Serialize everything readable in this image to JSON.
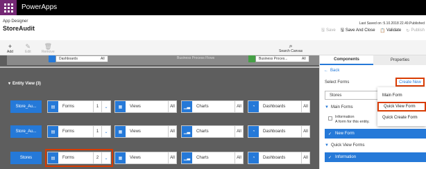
{
  "app": {
    "title": "PowerApps"
  },
  "header": {
    "breadcrumb": "App Designer",
    "title": "StoreAudit",
    "saved": "Last Saved on :5.10.2018 22.49.Published",
    "actions": [
      {
        "label": "Save",
        "icon": "save-icon",
        "enabled": false
      },
      {
        "label": "Save And Close",
        "icon": "save-close-icon",
        "enabled": true
      },
      {
        "label": "Validate",
        "icon": "validate-icon",
        "enabled": true
      },
      {
        "label": "Publish",
        "icon": "publish-icon",
        "enabled": false
      }
    ]
  },
  "commandbar": {
    "add": "Add",
    "edit": "Edit",
    "remove": "Remove",
    "search": "Search Canvas"
  },
  "canvas": {
    "top_partial": {
      "dashboards": "Dashboards",
      "all": "All",
      "business": "Business Process Flows",
      "business2": "Business Proces..."
    },
    "section": "Entity View (3)",
    "rows": [
      {
        "entity": "Store_Au...",
        "forms": "Forms",
        "forms_count": "1",
        "views": "Views",
        "views_count": "All",
        "charts": "Charts",
        "charts_count": "All",
        "dashboards": "Dashboards",
        "dashboards_count": "All"
      },
      {
        "entity": "Store_Au...",
        "forms": "Forms",
        "forms_count": "1",
        "views": "Views",
        "views_count": "All",
        "charts": "Charts",
        "charts_count": "All",
        "dashboards": "Dashboards",
        "dashboards_count": "All"
      },
      {
        "entity": "Stores",
        "forms": "Forms",
        "forms_count": "2",
        "views": "Views",
        "views_count": "All",
        "charts": "Charts",
        "charts_count": "All",
        "dashboards": "Dashboards",
        "dashboards_count": "All"
      }
    ]
  },
  "panel": {
    "tabs": [
      "Components",
      "Properties"
    ],
    "back": "Back",
    "select_label": "Select Forms",
    "create_new": "Create New",
    "select_value": "Stores",
    "main_forms": "Main Forms",
    "info_title": "Information",
    "info_desc": "A form for this entity.",
    "new_form": "New Form",
    "quick_view_forms": "Quick View Forms",
    "qv_info": "Information"
  },
  "menu": {
    "items": [
      "Main Form",
      "Quick View Form",
      "Quick Create Form"
    ]
  },
  "colors": {
    "accent": "#2579d8",
    "brand": "#742774",
    "highlight": "#d83b01",
    "canvas": "#5e5e5e"
  }
}
